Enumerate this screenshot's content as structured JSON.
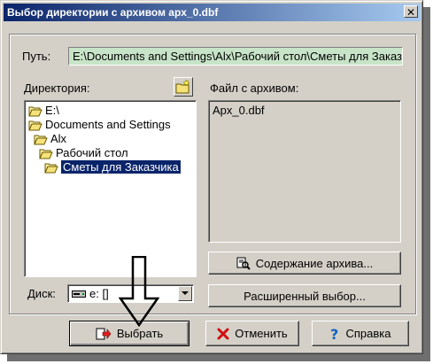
{
  "window": {
    "title": "Выбор директории с архивом apx_0.dbf",
    "close_glyph": "✕"
  },
  "path": {
    "label": "Путь:",
    "value": "E:\\Documents and Settings\\Alx\\Рабочий стол\\Сметы для Заказчика"
  },
  "directory": {
    "label": "Директория:",
    "tree": [
      {
        "label": "E:\\"
      },
      {
        "label": "Documents and Settings"
      },
      {
        "label": "Alx"
      },
      {
        "label": "Рабочий стол"
      },
      {
        "label": "Сметы для Заказчика",
        "selected": true
      }
    ]
  },
  "archive_file": {
    "label": "Файл с архивом:",
    "files": [
      "Apx_0.dbf"
    ]
  },
  "drive": {
    "label": "Диск:",
    "value": "e: []"
  },
  "buttons": {
    "contents": "Содержание архива...",
    "extended": "Расширенный выбор...",
    "select": "Выбрать",
    "cancel": "Отменить",
    "help": "Справка"
  },
  "icons": {
    "folder": "folder-icon",
    "open_folder": "open-folder-icon",
    "new_folder": "new-folder-icon",
    "magnifier": "magnifier-icon",
    "select": "select-arrow-icon",
    "cancel": "red-x-icon",
    "help": "question-icon",
    "drive": "drive-icon"
  },
  "colors": {
    "title_start": "#0a246a",
    "title_end": "#a6caf0",
    "path_bg": "#c8e4c8",
    "selection": "#0a246a",
    "face": "#d4d0c8"
  }
}
